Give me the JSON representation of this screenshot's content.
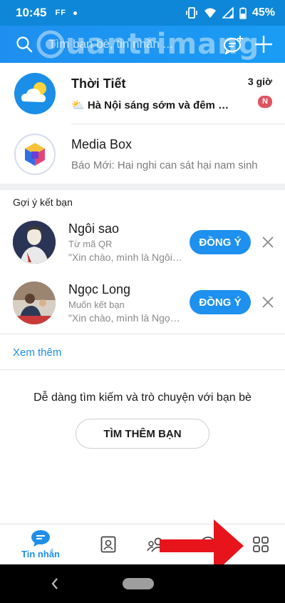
{
  "status_bar": {
    "time": "10:45",
    "app_indicator": "FF",
    "battery": "45%"
  },
  "header": {
    "search_placeholder": "Tìm bạn bè, tin nhắn ...",
    "watermark": "uantrimang"
  },
  "conversations": [
    {
      "title": "Thời Tiết",
      "preview": "⛅ Hà Nội sáng sớm và đêm dịu mát",
      "time": "3 giờ",
      "badge": "N",
      "unread": true
    },
    {
      "title": "Media Box",
      "preview": "Báo Mới: Hai nghi can sát hại nam sinh",
      "unread": false
    }
  ],
  "suggestions": {
    "title": "Gợi ý kết bạn",
    "items": [
      {
        "name": "Ngôi sao",
        "source": "Từ mã QR",
        "message": "\"Xin chào, mình là Ngôi sao\"",
        "accept_label": "ĐỒNG Ý"
      },
      {
        "name": "Ngọc Long",
        "source": "Muốn kết bạn",
        "message": "\"Xin chào, mình là Ngọc Long\"",
        "accept_label": "ĐỒNG Ý"
      }
    ],
    "see_more": "Xem thêm"
  },
  "discover": {
    "text": "Dễ dàng tìm kiếm và trò chuyện với bạn bè",
    "button": "TÌM THÊM BẠN"
  },
  "bottom_nav": {
    "messages_label": "Tin nhắn"
  },
  "colors": {
    "brand": "#1e90ef",
    "badge": "#e0525f",
    "arrow": "#e8141c"
  }
}
